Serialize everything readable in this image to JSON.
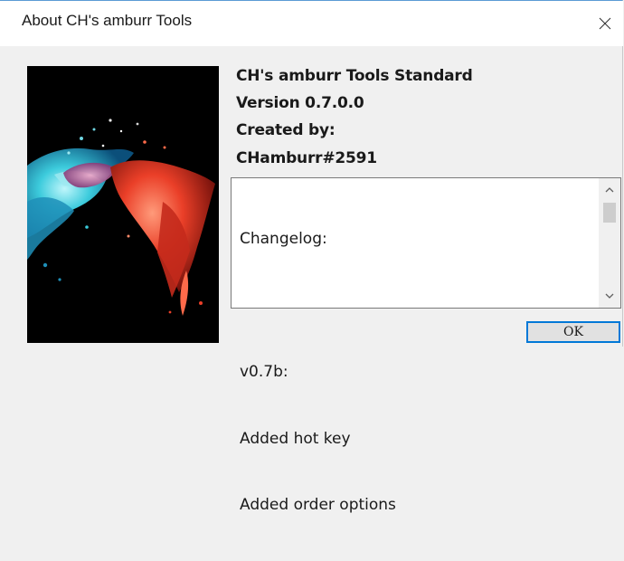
{
  "window": {
    "title": "About CH's amburr Tools",
    "close_icon": "close-icon"
  },
  "info": {
    "product": "CH's amburr Tools Standard",
    "version": "Version 0.7.0.0",
    "created_by_label": "Created by:",
    "author": "CHamburr#2591"
  },
  "changelog": {
    "lines": [
      "Changelog:",
      "",
      "v0.7b:",
      "Added hot key",
      "Added order options"
    ],
    "scroll_up_icon": "chevron-up-icon",
    "scroll_down_icon": "chevron-down-icon"
  },
  "buttons": {
    "ok_label": "OK"
  },
  "colors": {
    "accent": "#0078d7",
    "background": "#f0f0f0",
    "titlebar": "#ffffff",
    "splash_red": "#e8402c",
    "splash_cyan": "#39c9d9"
  }
}
